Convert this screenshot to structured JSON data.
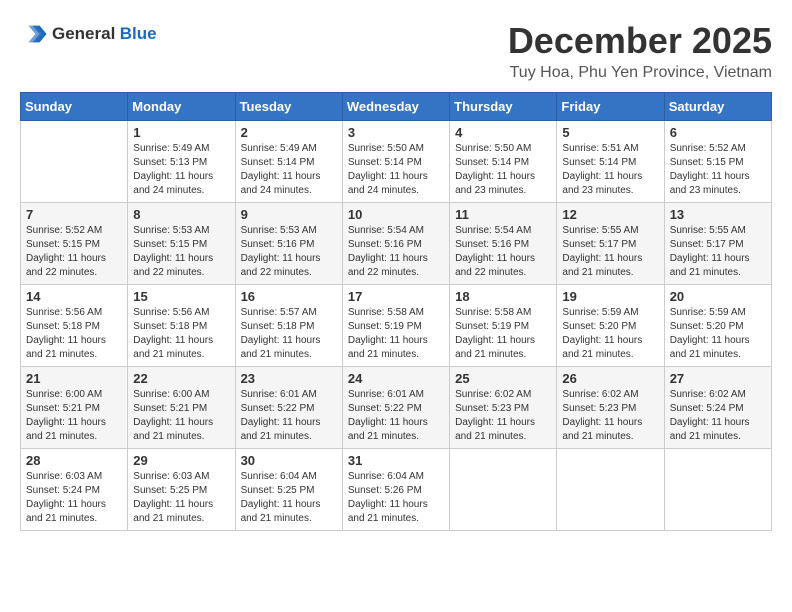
{
  "header": {
    "logo_general": "General",
    "logo_blue": "Blue",
    "month_title": "December 2025",
    "location": "Tuy Hoa, Phu Yen Province, Vietnam"
  },
  "calendar": {
    "days_of_week": [
      "Sunday",
      "Monday",
      "Tuesday",
      "Wednesday",
      "Thursday",
      "Friday",
      "Saturday"
    ],
    "weeks": [
      [
        {
          "day": "",
          "info": ""
        },
        {
          "day": "1",
          "info": "Sunrise: 5:49 AM\nSunset: 5:13 PM\nDaylight: 11 hours\nand 24 minutes."
        },
        {
          "day": "2",
          "info": "Sunrise: 5:49 AM\nSunset: 5:14 PM\nDaylight: 11 hours\nand 24 minutes."
        },
        {
          "day": "3",
          "info": "Sunrise: 5:50 AM\nSunset: 5:14 PM\nDaylight: 11 hours\nand 24 minutes."
        },
        {
          "day": "4",
          "info": "Sunrise: 5:50 AM\nSunset: 5:14 PM\nDaylight: 11 hours\nand 23 minutes."
        },
        {
          "day": "5",
          "info": "Sunrise: 5:51 AM\nSunset: 5:14 PM\nDaylight: 11 hours\nand 23 minutes."
        },
        {
          "day": "6",
          "info": "Sunrise: 5:52 AM\nSunset: 5:15 PM\nDaylight: 11 hours\nand 23 minutes."
        }
      ],
      [
        {
          "day": "7",
          "info": "Sunrise: 5:52 AM\nSunset: 5:15 PM\nDaylight: 11 hours\nand 22 minutes."
        },
        {
          "day": "8",
          "info": "Sunrise: 5:53 AM\nSunset: 5:15 PM\nDaylight: 11 hours\nand 22 minutes."
        },
        {
          "day": "9",
          "info": "Sunrise: 5:53 AM\nSunset: 5:16 PM\nDaylight: 11 hours\nand 22 minutes."
        },
        {
          "day": "10",
          "info": "Sunrise: 5:54 AM\nSunset: 5:16 PM\nDaylight: 11 hours\nand 22 minutes."
        },
        {
          "day": "11",
          "info": "Sunrise: 5:54 AM\nSunset: 5:16 PM\nDaylight: 11 hours\nand 22 minutes."
        },
        {
          "day": "12",
          "info": "Sunrise: 5:55 AM\nSunset: 5:17 PM\nDaylight: 11 hours\nand 21 minutes."
        },
        {
          "day": "13",
          "info": "Sunrise: 5:55 AM\nSunset: 5:17 PM\nDaylight: 11 hours\nand 21 minutes."
        }
      ],
      [
        {
          "day": "14",
          "info": "Sunrise: 5:56 AM\nSunset: 5:18 PM\nDaylight: 11 hours\nand 21 minutes."
        },
        {
          "day": "15",
          "info": "Sunrise: 5:56 AM\nSunset: 5:18 PM\nDaylight: 11 hours\nand 21 minutes."
        },
        {
          "day": "16",
          "info": "Sunrise: 5:57 AM\nSunset: 5:18 PM\nDaylight: 11 hours\nand 21 minutes."
        },
        {
          "day": "17",
          "info": "Sunrise: 5:58 AM\nSunset: 5:19 PM\nDaylight: 11 hours\nand 21 minutes."
        },
        {
          "day": "18",
          "info": "Sunrise: 5:58 AM\nSunset: 5:19 PM\nDaylight: 11 hours\nand 21 minutes."
        },
        {
          "day": "19",
          "info": "Sunrise: 5:59 AM\nSunset: 5:20 PM\nDaylight: 11 hours\nand 21 minutes."
        },
        {
          "day": "20",
          "info": "Sunrise: 5:59 AM\nSunset: 5:20 PM\nDaylight: 11 hours\nand 21 minutes."
        }
      ],
      [
        {
          "day": "21",
          "info": "Sunrise: 6:00 AM\nSunset: 5:21 PM\nDaylight: 11 hours\nand 21 minutes."
        },
        {
          "day": "22",
          "info": "Sunrise: 6:00 AM\nSunset: 5:21 PM\nDaylight: 11 hours\nand 21 minutes."
        },
        {
          "day": "23",
          "info": "Sunrise: 6:01 AM\nSunset: 5:22 PM\nDaylight: 11 hours\nand 21 minutes."
        },
        {
          "day": "24",
          "info": "Sunrise: 6:01 AM\nSunset: 5:22 PM\nDaylight: 11 hours\nand 21 minutes."
        },
        {
          "day": "25",
          "info": "Sunrise: 6:02 AM\nSunset: 5:23 PM\nDaylight: 11 hours\nand 21 minutes."
        },
        {
          "day": "26",
          "info": "Sunrise: 6:02 AM\nSunset: 5:23 PM\nDaylight: 11 hours\nand 21 minutes."
        },
        {
          "day": "27",
          "info": "Sunrise: 6:02 AM\nSunset: 5:24 PM\nDaylight: 11 hours\nand 21 minutes."
        }
      ],
      [
        {
          "day": "28",
          "info": "Sunrise: 6:03 AM\nSunset: 5:24 PM\nDaylight: 11 hours\nand 21 minutes."
        },
        {
          "day": "29",
          "info": "Sunrise: 6:03 AM\nSunset: 5:25 PM\nDaylight: 11 hours\nand 21 minutes."
        },
        {
          "day": "30",
          "info": "Sunrise: 6:04 AM\nSunset: 5:25 PM\nDaylight: 11 hours\nand 21 minutes."
        },
        {
          "day": "31",
          "info": "Sunrise: 6:04 AM\nSunset: 5:26 PM\nDaylight: 11 hours\nand 21 minutes."
        },
        {
          "day": "",
          "info": ""
        },
        {
          "day": "",
          "info": ""
        },
        {
          "day": "",
          "info": ""
        }
      ]
    ]
  }
}
